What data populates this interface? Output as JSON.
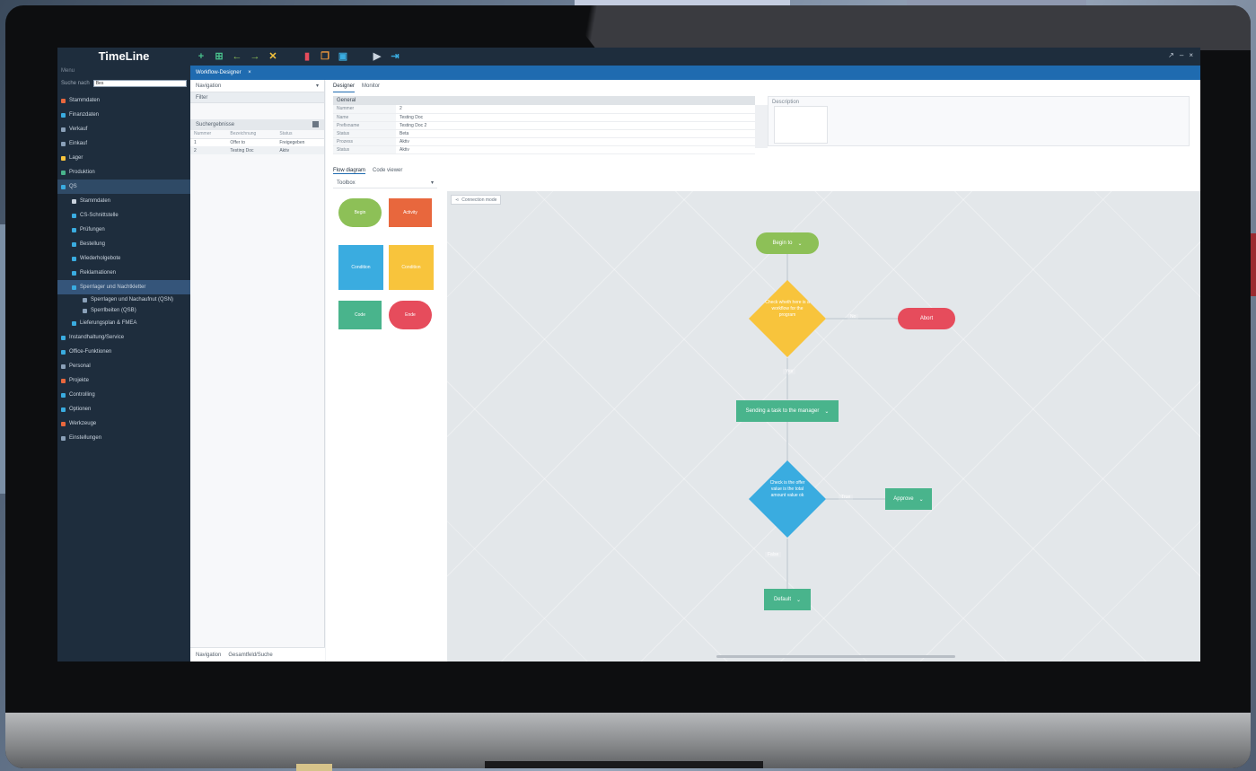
{
  "app": {
    "title": "TimeLine",
    "menu_caption": "Menu",
    "search_label": "Suche nach",
    "search_value": "Bes"
  },
  "colors": {
    "sidebar_bg": "#1e2d3d",
    "tabbar_blue": "#1f6bb0",
    "green": "#8dc057",
    "orange": "#e8673d",
    "blue": "#3aace0",
    "yellow": "#f8c43c",
    "teal": "#49b48c",
    "red": "#e64c5c"
  },
  "sidebar": {
    "items": [
      {
        "label": "Stammdaten",
        "color": "#e8673d",
        "level": 0
      },
      {
        "label": "Finanzdaten",
        "color": "#3aace0",
        "level": 0
      },
      {
        "label": "Verkauf",
        "color": "#8aa0b8",
        "level": 0
      },
      {
        "label": "Einkauf",
        "color": "#8aa0b8",
        "level": 0
      },
      {
        "label": "Lager",
        "color": "#f8c43c",
        "level": 0
      },
      {
        "label": "Produktion",
        "color": "#49b48c",
        "level": 0
      },
      {
        "label": "QS",
        "color": "#3aace0",
        "level": 0,
        "active": true
      },
      {
        "label": "Stammdaten",
        "color": "#c9d3de",
        "level": 1
      },
      {
        "label": "CS-Schnittstelle",
        "color": "#3aace0",
        "level": 1
      },
      {
        "label": "Prüfungen",
        "color": "#3aace0",
        "level": 1
      },
      {
        "label": "Bestellung",
        "color": "#3aace0",
        "level": 1
      },
      {
        "label": "Wiederholgebote",
        "color": "#3aace0",
        "level": 1
      },
      {
        "label": "Reklamationen",
        "color": "#3aace0",
        "level": 1
      },
      {
        "label": "Sperrlager und Nachtkletter",
        "color": "#3aace0",
        "level": 1,
        "selected": true
      },
      {
        "label": "Sperrlagen und Nachaufnut (QSN)",
        "color": "#8aa0b8",
        "level": 2
      },
      {
        "label": "Sperrlbeiten (QSB)",
        "color": "#8aa0b8",
        "level": 2
      },
      {
        "label": "Lieferungsplan & FMEA",
        "color": "#3aace0",
        "level": 1
      },
      {
        "label": "Instandhaltung/Service",
        "color": "#3aace0",
        "level": 0
      },
      {
        "label": "Office-Funktionen",
        "color": "#3aace0",
        "level": 0
      },
      {
        "label": "Personal",
        "color": "#8aa0b8",
        "level": 0
      },
      {
        "label": "Projekte",
        "color": "#e8673d",
        "level": 0
      },
      {
        "label": "Controlling",
        "color": "#3aace0",
        "level": 0
      },
      {
        "label": "Optionen",
        "color": "#3aace0",
        "level": 0
      },
      {
        "label": "Werkzeuge",
        "color": "#e8673d",
        "level": 0
      },
      {
        "label": "Einstellungen",
        "color": "#8aa0b8",
        "level": 0
      }
    ]
  },
  "toolbar": {
    "buttons": [
      {
        "name": "add-icon",
        "glyph": "+",
        "color": "#49c08c"
      },
      {
        "name": "add-copy-icon",
        "glyph": "⊞",
        "color": "#49c08c"
      },
      {
        "name": "back-arrow-icon",
        "glyph": "←",
        "color": "#8dc057"
      },
      {
        "name": "forward-arrow-icon",
        "glyph": "→",
        "color": "#8dc057"
      },
      {
        "name": "tools-icon",
        "glyph": "✕",
        "color": "#f8c43c"
      },
      {
        "name": "delete-icon",
        "glyph": "▮",
        "color": "#e64c5c"
      },
      {
        "name": "copy-icon",
        "glyph": "❐",
        "color": "#f29a3c"
      },
      {
        "name": "save-icon",
        "glyph": "▣",
        "color": "#3aace0"
      },
      {
        "name": "run-icon",
        "glyph": "▶",
        "color": "#c9d3de"
      },
      {
        "name": "exit-icon",
        "glyph": "⇥",
        "color": "#3aace0"
      }
    ],
    "window_controls": [
      "↗",
      "–",
      "×"
    ]
  },
  "tab": {
    "label": "Workflow-Designer",
    "close": "×"
  },
  "nav_panel": {
    "header": "Navigation",
    "filter": "Filter",
    "section": "Suchergebnisse",
    "columns": [
      "Nummer",
      "Bezeichnung",
      "Status"
    ],
    "rows": [
      [
        "1",
        "Offer to",
        "Freigegeben"
      ],
      [
        "2",
        "Testing Doc",
        "Aktiv"
      ]
    ],
    "bottom_tabs": [
      "Navigation",
      "Gesamtfeld/Suche"
    ]
  },
  "main": {
    "tabs": [
      "Designer",
      "Monitor"
    ],
    "general_header": "General",
    "properties": [
      {
        "key": "Nummer",
        "value": "2"
      },
      {
        "key": "Name",
        "value": "Testing Doc"
      },
      {
        "key": "Prefixname",
        "value": "Testing Doc 2"
      },
      {
        "key": "Status",
        "value": "Beta"
      },
      {
        "key": "Prozess",
        "value": "Aktiv"
      },
      {
        "key": "Status",
        "value": "Aktiv"
      }
    ],
    "description_label": "Description",
    "flow_tabs": [
      "Flow diagram",
      "Code viewer"
    ],
    "tools_header": "Toolbox"
  },
  "palette": [
    {
      "label": "Begin",
      "shape": "pill",
      "color": "#8dc057"
    },
    {
      "label": "Activity",
      "shape": "rect",
      "color": "#e8673d"
    },
    {
      "label": "Condition",
      "shape": "diamond",
      "color": "#3aace0"
    },
    {
      "label": "Condition",
      "shape": "diamond",
      "color": "#f8c43c"
    },
    {
      "label": "Code",
      "shape": "rect",
      "color": "#49b48c"
    },
    {
      "label": "Ende",
      "shape": "pill",
      "color": "#e64c5c"
    }
  ],
  "canvas": {
    "connection_button": "Connection mode",
    "nodes": {
      "begin": "Begin to",
      "decision1": "Check wheth here is a workflow for the program",
      "abort": "Abort",
      "process": "Sending a task to the manager",
      "decision2": "Check is the offer value is the total amount value ok",
      "approve": "Approve",
      "end": "Default"
    },
    "edge_labels": {
      "no1": "No",
      "yes1": "Yes",
      "yes2": "True",
      "no2": "False"
    }
  }
}
